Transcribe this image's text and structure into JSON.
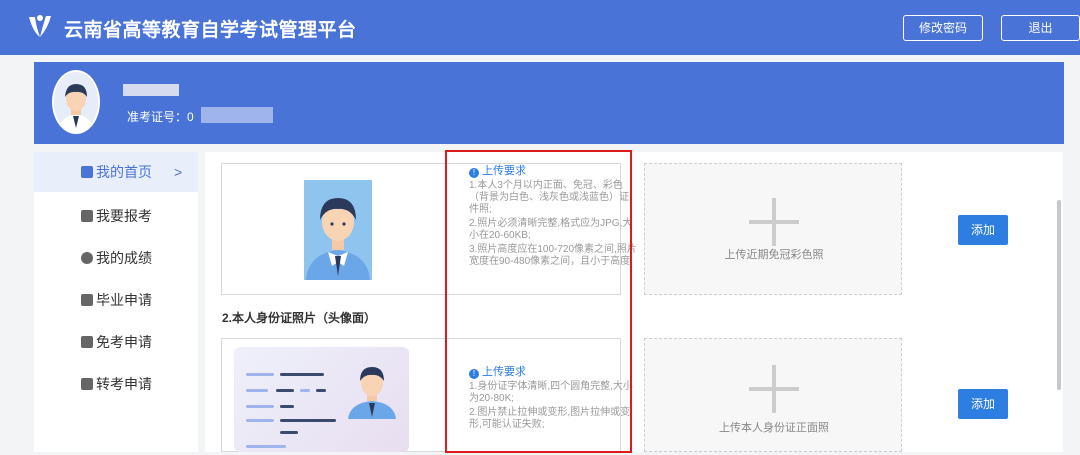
{
  "header": {
    "title": "云南省高等教育自学考试管理平台",
    "change_password": "修改密码",
    "logout": "退出"
  },
  "profile": {
    "exam_no_label": "准考证号：0"
  },
  "sidebar": {
    "items": [
      {
        "label": "我的首页",
        "icon": "home-icon"
      },
      {
        "label": "我要报考",
        "icon": "register-icon"
      },
      {
        "label": "我的成绩",
        "icon": "score-icon"
      },
      {
        "label": "毕业申请",
        "icon": "graduation-icon"
      },
      {
        "label": "免考申请",
        "icon": "exemption-icon"
      },
      {
        "label": "转考申请",
        "icon": "transfer-icon"
      }
    ],
    "active_index": 0,
    "chevron": ">"
  },
  "main": {
    "photo": {
      "req_title": "上传要求",
      "requirements": [
        "1.本人3个月以内正面、免冠、彩色（背景为白色、浅灰色或浅蓝色）证件照;",
        "2.照片必须清晰完整,格式应为JPG,大小在20-60KB;",
        "3.照片高度应在100-720像素之间,照片宽度在90-480像素之间，且小于高度;"
      ],
      "upload_label": "上传近期免冠彩色照",
      "add_label": "添加"
    },
    "id_section_title": "2.本人身份证照片（头像面）",
    "id": {
      "req_title": "上传要求",
      "requirements": [
        "1.身份证字体清晰,四个圆角完整,大小为20-80K;",
        "2.图片禁止拉伸或变形,图片拉伸或变形,可能认证失败;"
      ],
      "upload_label": "上传本人身份证正面照",
      "add_label": "添加"
    }
  },
  "colors": {
    "brand": "#4a73d8",
    "button": "#2e7de1",
    "highlight": "#e0191b"
  }
}
